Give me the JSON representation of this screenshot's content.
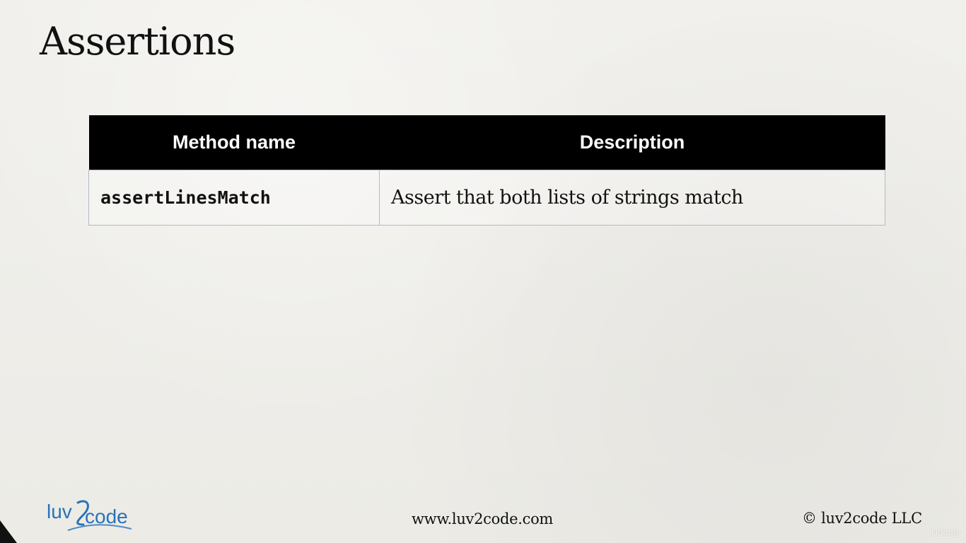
{
  "slide": {
    "title": "Assertions"
  },
  "table": {
    "headers": [
      "Method name",
      "Description"
    ],
    "rows": [
      {
        "method": "assertLinesMatch",
        "description": "Assert that both lists of strings match"
      }
    ]
  },
  "footer": {
    "logo_text_left": "luv",
    "logo_text_right": "code",
    "logo_numeral": "2",
    "url": "www.luv2code.com",
    "copyright": "© luv2code LLC"
  },
  "watermark": {
    "text": "Udemy"
  },
  "colors": {
    "paper": "#efeeea",
    "header_bg": "#000000",
    "header_text": "#ffffff",
    "cell_border": "#b7b7c8",
    "text": "#111111",
    "logo_blue": "#2a72b8"
  }
}
